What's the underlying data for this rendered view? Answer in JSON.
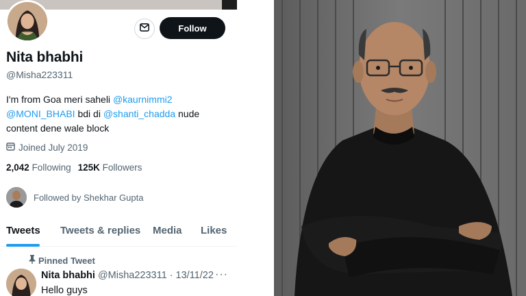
{
  "profile": {
    "display_name": "Nita bhabhi",
    "handle": "@Misha223311",
    "follow_label": "Follow",
    "bio": {
      "part1": "I'm from Goa meri saheli ",
      "mention1": "@kaurnimmi2",
      "mention2": "@MONI_BHABI",
      "part2": " bdi di ",
      "mention3": "@shanti_chadda",
      "part3": " nude content dene wale block"
    },
    "joined": "Joined July 2019",
    "following_count": "2,042",
    "following_label": "Following",
    "followers_count": "125K",
    "followers_label": "Followers",
    "followed_by": "Followed by Shekhar Gupta",
    "tabs": [
      "Tweets",
      "Tweets & replies",
      "Media",
      "Likes"
    ],
    "active_tab": "Tweets",
    "pinned_label": "Pinned Tweet",
    "tweet": {
      "name": "Nita bhabhi",
      "handle": "@Misha223311",
      "date": "· 13/11/22",
      "more": "···",
      "text": "Hello guys"
    }
  },
  "icons": {
    "message": "envelope-icon",
    "calendar": "calendar-icon",
    "pin": "pin-icon"
  },
  "colors": {
    "accent": "#1d9bf0",
    "follow_button": "#0f1419",
    "secondary_text": "#536471"
  }
}
